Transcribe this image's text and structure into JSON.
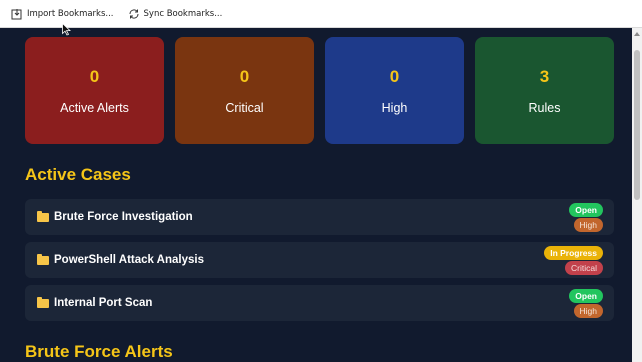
{
  "toolbar": {
    "import_label": "Import Bookmarks...",
    "sync_label": "Sync Bookmarks..."
  },
  "stats": [
    {
      "value": "0",
      "label": "Active Alerts",
      "color": "#8b1e1e"
    },
    {
      "value": "0",
      "label": "Critical",
      "color": "#7a3510"
    },
    {
      "value": "0",
      "label": "High",
      "color": "#1e3a8a"
    },
    {
      "value": "3",
      "label": "Rules",
      "color": "#1a5630"
    }
  ],
  "sections": {
    "active_cases": "Active Cases",
    "brute_force_alerts": "Brute Force Alerts"
  },
  "cases": [
    {
      "title": "Brute Force Investigation",
      "status": "Open",
      "severity": "High"
    },
    {
      "title": "PowerShell Attack Analysis",
      "status": "In Progress",
      "severity": "Critical"
    },
    {
      "title": "Internal Port Scan",
      "status": "Open",
      "severity": "High"
    }
  ]
}
